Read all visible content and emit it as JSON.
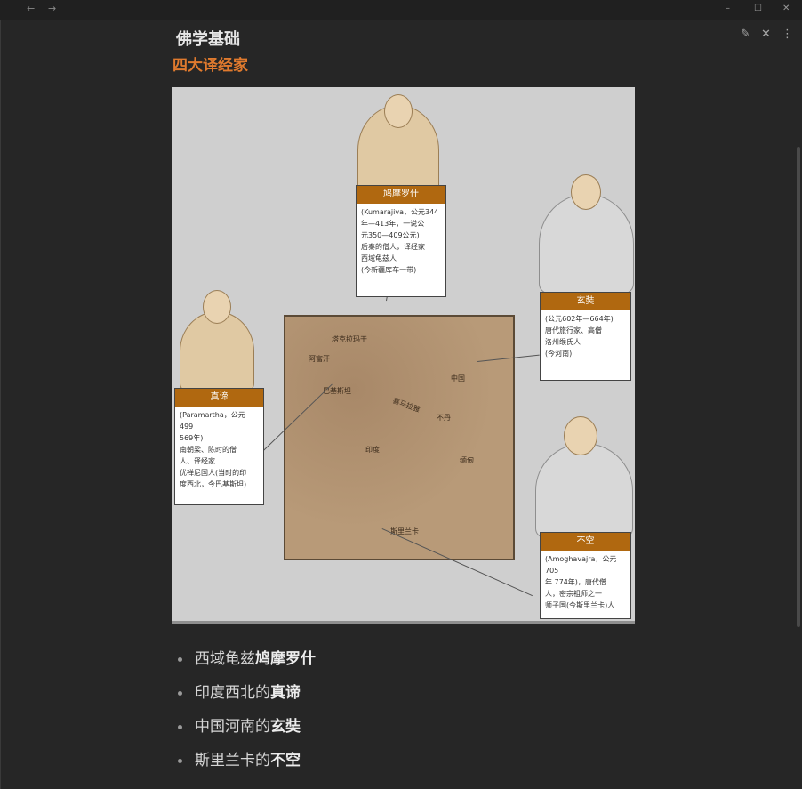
{
  "window": {
    "nav_back": "←",
    "nav_forward": "→",
    "minimize": "–",
    "maximize": "☐",
    "close": "✕"
  },
  "toolbar": {
    "edit_icon": "✎",
    "close_icon": "✕",
    "more_icon": "⋮"
  },
  "note": {
    "title": "佛学基础",
    "subtitle": "四大译经家",
    "subtitle_color": "#e07a2e"
  },
  "figure": {
    "map_labels": {
      "taklamakan": "塔克拉玛干",
      "afghanistan": "阿富汗",
      "pakistan": "巴基斯坦",
      "china": "中国",
      "himalaya": "喜马拉雅",
      "nepal": "不丹",
      "india": "印度",
      "myanmar": "缅甸",
      "srilanka": "斯里兰卡"
    },
    "cards": {
      "kumarajiva": {
        "name": "鸠摩罗什",
        "desc": "(Kumarajiva，公元344\n年—413年，一说公\n元350—409公元)\n后秦的僧人，译经家\n西域龟兹人\n(今新疆库车一带)"
      },
      "xuanzang": {
        "name": "玄奘",
        "desc": "(公元602年—664年)\n唐代旅行家、高僧\n洛州缑氏人\n(今河南)"
      },
      "paramartha": {
        "name": "真谛",
        "desc": "(Paramartha，公元499\n569年)\n南朝梁、陈时的僧\n人、译经家\n优禅尼国人(当时的印\n度西北，今巴基斯坦)"
      },
      "amoghavajra": {
        "name": "不空",
        "desc": "(Amoghavajra，公元705\n年  774年)，唐代僧\n人，密宗祖师之一\n师子国(今斯里兰卡)人"
      }
    }
  },
  "list": [
    {
      "prefix": "西域龟兹",
      "bold": "鸠摩罗什"
    },
    {
      "prefix": "印度西北的",
      "bold": "真谛"
    },
    {
      "prefix": "中国河南的",
      "bold": "玄奘"
    },
    {
      "prefix": "斯里兰卡的",
      "bold": "不空"
    }
  ]
}
